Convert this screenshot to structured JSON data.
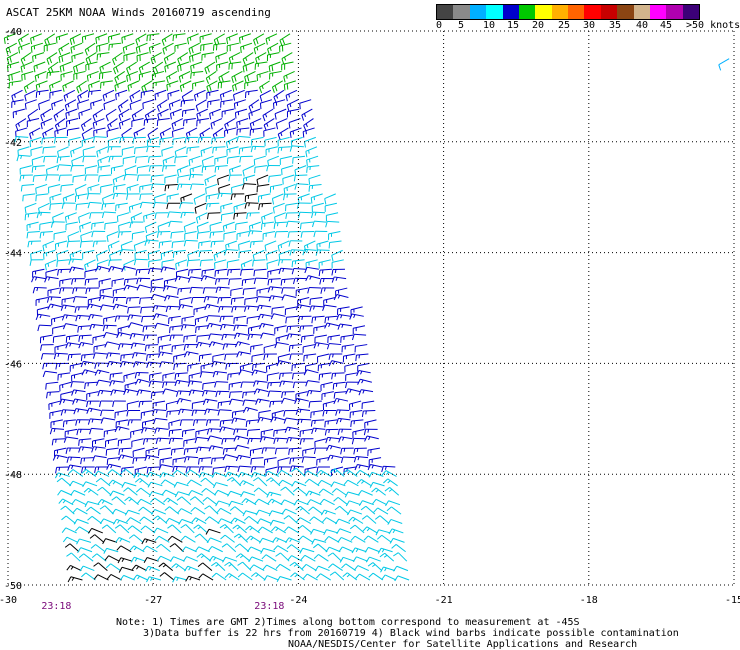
{
  "title": "ASCAT 25KM NOAA Winds 20160719 ascending",
  "legend": {
    "labels": [
      "0",
      "5",
      "10",
      "15",
      "20",
      "25",
      "30",
      "35",
      "40",
      "45",
      ">50 knots"
    ],
    "colors": [
      "#444444",
      "#8a8a8a",
      "#00b0ff",
      "#00ffff",
      "#0000cd",
      "#00c800",
      "#ffff00",
      "#ffb000",
      "#ff6400",
      "#ff0000",
      "#c80000",
      "#8b4513",
      "#d2b48c",
      "#ff00ff",
      "#b000b0",
      "#3c0078"
    ]
  },
  "axes": {
    "longitude_labels": [
      "-30",
      "-27",
      "-24",
      "-21",
      "-18",
      "-15"
    ],
    "latitude_labels": [
      "-40",
      "-42",
      "-44",
      "-46",
      "-48",
      "-50"
    ],
    "longitude_values": [
      -30,
      -27,
      -24,
      -21,
      -18,
      -15
    ],
    "latitude_values": [
      -40,
      -42,
      -44,
      -46,
      -48,
      -50
    ]
  },
  "pass_times": [
    {
      "label": "23:18",
      "lon": -29.0
    },
    {
      "label": "23:18",
      "lon": -24.6
    }
  ],
  "notes": {
    "line1": "Note: 1) Times are GMT 2)Times along bottom correspond to measurement at -45S",
    "line2": "3)Data buffer is 22 hrs from 20160719 4) Black wind barbs indicate possible contamination",
    "line3": "NOAA/NESDIS/Center for Satellite Applications and Research"
  },
  "swath": {
    "west_edge": [
      {
        "lat": -40.0,
        "lon": -29.9
      },
      {
        "lat": -50.0,
        "lon": -28.5
      }
    ],
    "east_edge": [
      {
        "lat": -40.0,
        "lon": -24.1
      },
      {
        "lat": -41.0,
        "lon": -23.8
      },
      {
        "lat": -44.0,
        "lon": -22.9
      },
      {
        "lat": -50.0,
        "lon": -21.5
      }
    ]
  },
  "wind_regions": [
    {
      "lat_min": -41.0,
      "lat_max": -40.0,
      "speed": 17,
      "color": "#00b000",
      "dir": 250
    },
    {
      "lat_min": -41.8,
      "lat_max": -41.0,
      "speed": 14,
      "color": "#0000cd",
      "dir": 250
    },
    {
      "lat_min": -44.2,
      "lat_max": -41.8,
      "speed": 12,
      "color": "#00c8e6",
      "dir": 260
    },
    {
      "lat_min": -48.0,
      "lat_max": -44.2,
      "speed": 14,
      "color": "#0000cd",
      "dir": 270
    },
    {
      "lat_min": -50.0,
      "lat_max": -48.0,
      "speed": 11,
      "color": "#00c8e6",
      "dir": 300
    }
  ],
  "edge_barb": {
    "lat": -40.5,
    "lon": -15.1,
    "color": "#00b0ff"
  }
}
